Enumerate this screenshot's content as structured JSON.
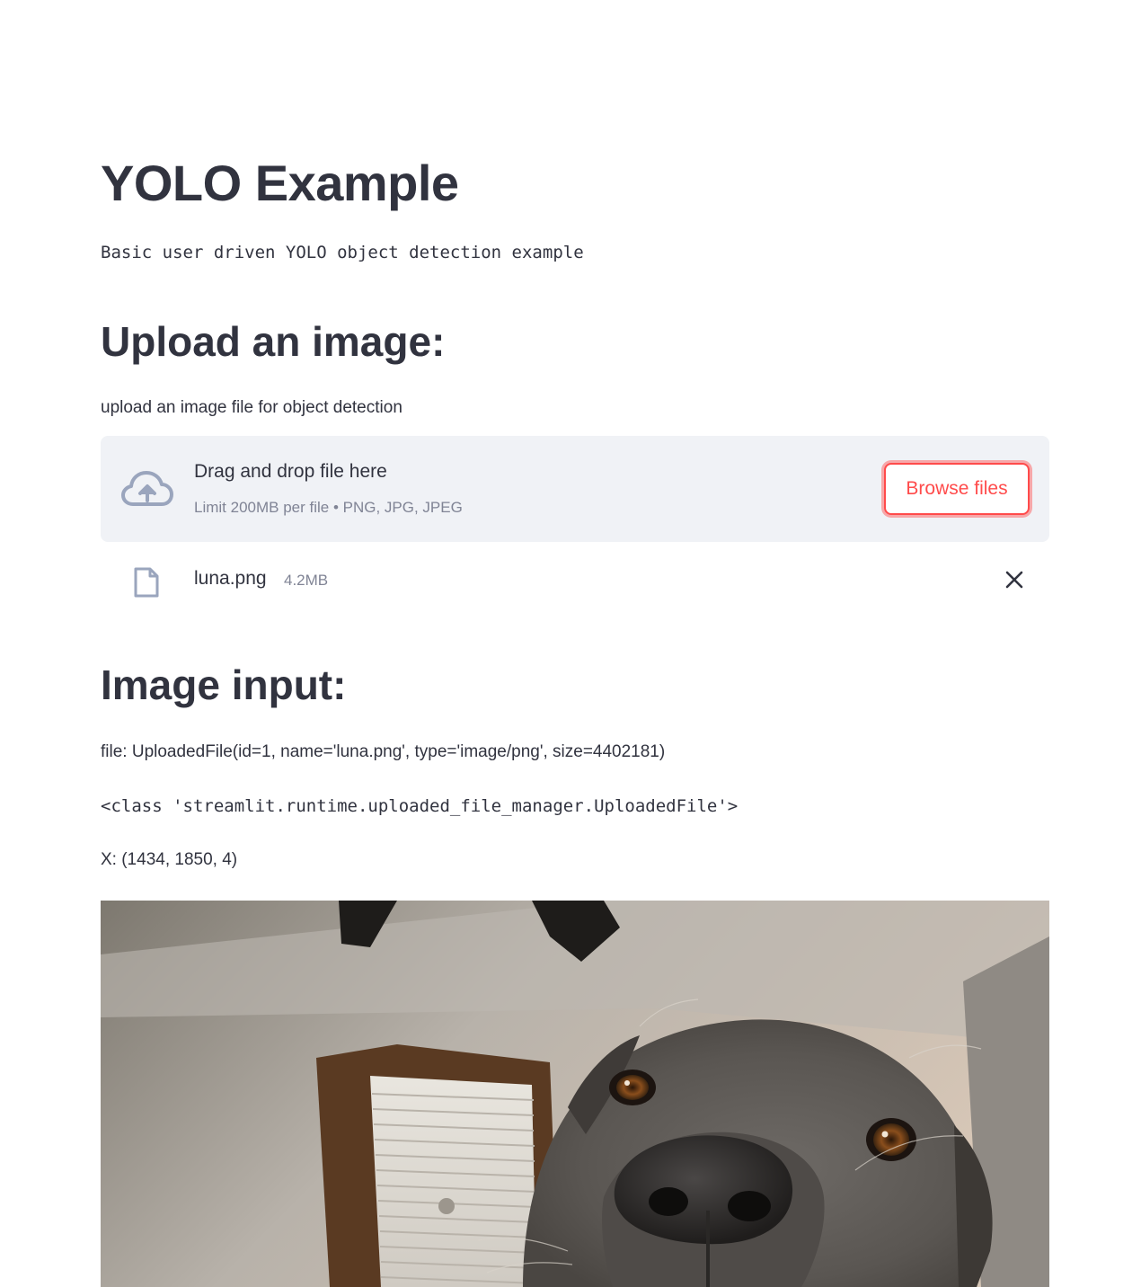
{
  "page": {
    "title": "YOLO Example",
    "subtitle": "Basic user driven YOLO object detection example"
  },
  "upload_section": {
    "heading": "Upload an image:",
    "label": "upload an image file for object detection",
    "dropzone": {
      "title": "Drag and drop file here",
      "limit_text": "Limit 200MB per file • PNG, JPG, JPEG",
      "browse_label": "Browse files"
    },
    "uploaded_file": {
      "name": "luna.png",
      "size": "4.2MB"
    }
  },
  "image_input_section": {
    "heading": "Image input:",
    "file_line": "file: UploadedFile(id=1, name='luna.png', type='image/png', size=4402181)",
    "class_line": "<class 'streamlit.runtime.uploaded_file_manager.UploadedFile'>",
    "shape_line": "X: (1434, 1850, 4)"
  },
  "colors": {
    "accent": "#ff4b4b",
    "text": "#31333f",
    "muted": "#808495",
    "dropzone_bg": "#f0f2f6"
  },
  "icons": [
    "cloud-upload-icon",
    "file-icon",
    "close-icon"
  ]
}
